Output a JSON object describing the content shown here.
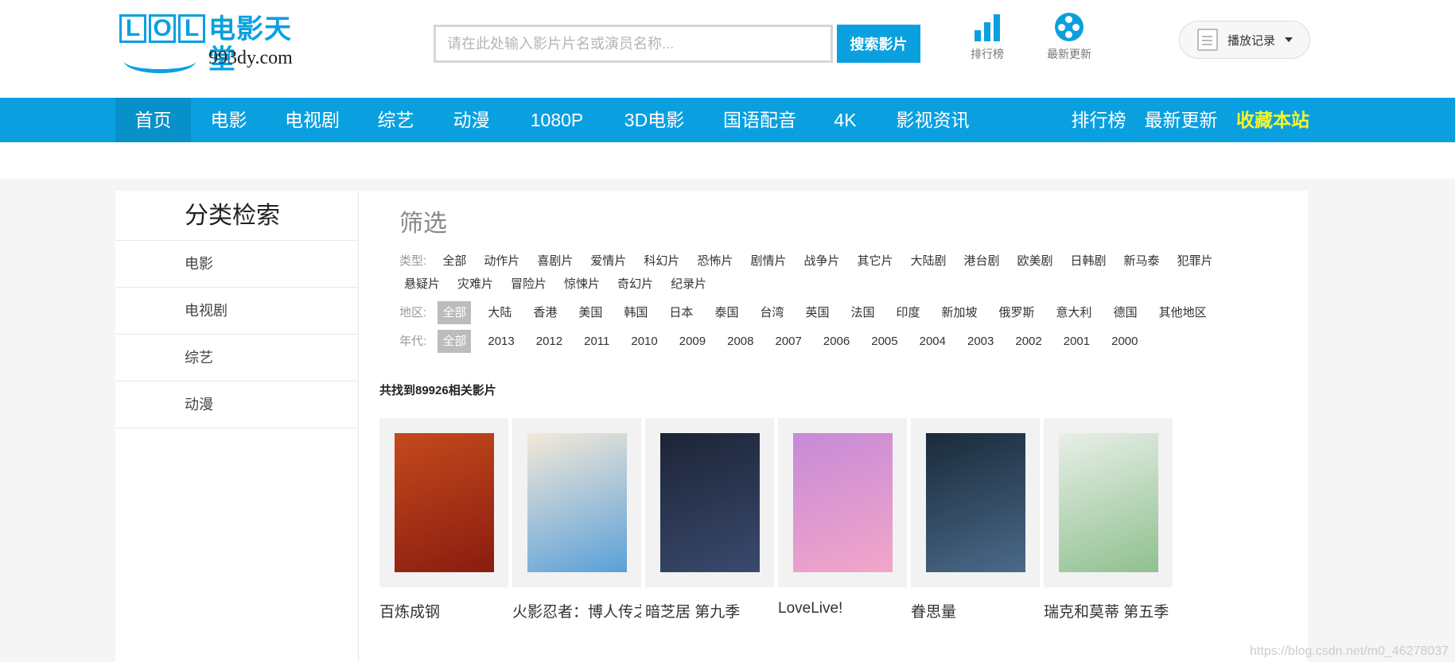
{
  "logo": {
    "letters": [
      "L",
      "O",
      "L"
    ],
    "name": "电影天堂",
    "domain": "993dy.com"
  },
  "search": {
    "placeholder": "请在此处输入影片片名或演员名称...",
    "button": "搜索影片"
  },
  "header_links": [
    {
      "label": "排行榜",
      "icon": "bar-chart-icon"
    },
    {
      "label": "最新更新",
      "icon": "film-reel-icon"
    }
  ],
  "history": {
    "label": "播放记录",
    "icon": "document-icon"
  },
  "nav": {
    "items": [
      "首页",
      "电影",
      "电视剧",
      "综艺",
      "动漫",
      "1080P",
      "3D电影",
      "国语配音",
      "4K",
      "影视资讯"
    ],
    "right": [
      "排行榜",
      "最新更新"
    ],
    "favorite": "收藏本站",
    "active": "首页"
  },
  "sidebar": {
    "title": "分类检索",
    "items": [
      "电影",
      "电视剧",
      "综艺",
      "动漫"
    ]
  },
  "filter": {
    "title": "筛选",
    "type_label": "类型:",
    "types": [
      "全部",
      "动作片",
      "喜剧片",
      "爱情片",
      "科幻片",
      "恐怖片",
      "剧情片",
      "战争片",
      "其它片",
      "大陆剧",
      "港台剧",
      "欧美剧",
      "日韩剧",
      "新马泰",
      "犯罪片",
      "悬疑片",
      "灾难片",
      "冒险片",
      "惊悚片",
      "奇幻片",
      "纪录片"
    ],
    "region_label": "地区:",
    "regions": [
      "全部",
      "大陆",
      "香港",
      "美国",
      "韩国",
      "日本",
      "泰国",
      "台湾",
      "英国",
      "法国",
      "印度",
      "新加坡",
      "俄罗斯",
      "意大利",
      "德国",
      "其他地区"
    ],
    "year_label": "年代:",
    "years": [
      "全部",
      "2013",
      "2012",
      "2011",
      "2010",
      "2009",
      "2008",
      "2007",
      "2006",
      "2005",
      "2004",
      "2003",
      "2002",
      "2001",
      "2000"
    ],
    "selected_region": "全部",
    "selected_year": "全部"
  },
  "results": {
    "found_text": "共找到89926相关影片"
  },
  "movies": [
    {
      "title": "百炼成钢",
      "poster_colors": [
        "#c44a1c",
        "#8a1c10"
      ]
    },
    {
      "title": "火影忍者：博人传之",
      "poster_colors": [
        "#f4e9d8",
        "#5aa0d8"
      ]
    },
    {
      "title": "暗芝居 第九季",
      "poster_colors": [
        "#1c2436",
        "#3a4a6e"
      ]
    },
    {
      "title": "LoveLive!",
      "poster_colors": [
        "#c78ad8",
        "#f2a6c8"
      ]
    },
    {
      "title": "眷思量",
      "poster_colors": [
        "#1a2a3a",
        "#4a6a8a"
      ]
    },
    {
      "title": "瑞克和莫蒂 第五季",
      "poster_colors": [
        "#e8efe8",
        "#8fc08f"
      ]
    }
  ],
  "watermark": "https://blog.csdn.net/m0_46278037"
}
